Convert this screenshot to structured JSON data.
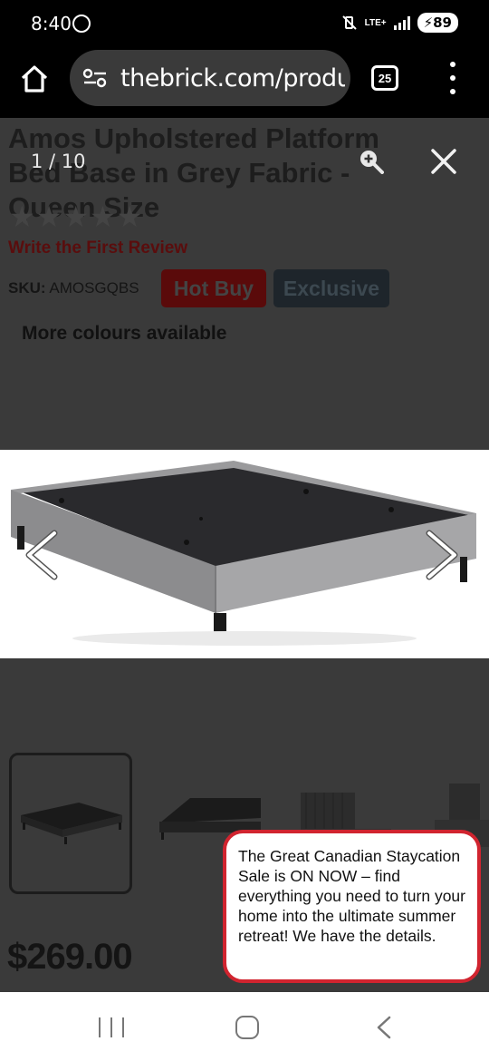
{
  "status_bar": {
    "time": "8:40",
    "network": "LTE+",
    "battery": "89"
  },
  "browser": {
    "url": "thebrick.com/products/amos",
    "tab_count": "25"
  },
  "product": {
    "title": "Amos Upholstered Platform Bed Base in Grey Fabric - Queen Size",
    "rating_stars": "★★★★★",
    "review_link": "Write the First Review",
    "sku_label": "SKU:",
    "sku_value": "AMOSGQBS",
    "badge_hot": "Hot Buy",
    "badge_exclusive": "Exclusive",
    "more_colours": "More colours available",
    "price": "$269.00"
  },
  "gallery": {
    "counter": "1 / 10",
    "current_index": 1,
    "total_images": 10
  },
  "promo": {
    "message": "The Great Canadian Staycation Sale is ON NOW – find everything you need to turn your home into the ultimate summer retreat! We have the details."
  },
  "colors": {
    "overlay_bg": "#3a3a3a",
    "promo_border": "#d1242f",
    "hot_buy": "#5a0a0a",
    "exclusive": "#1e252b"
  }
}
